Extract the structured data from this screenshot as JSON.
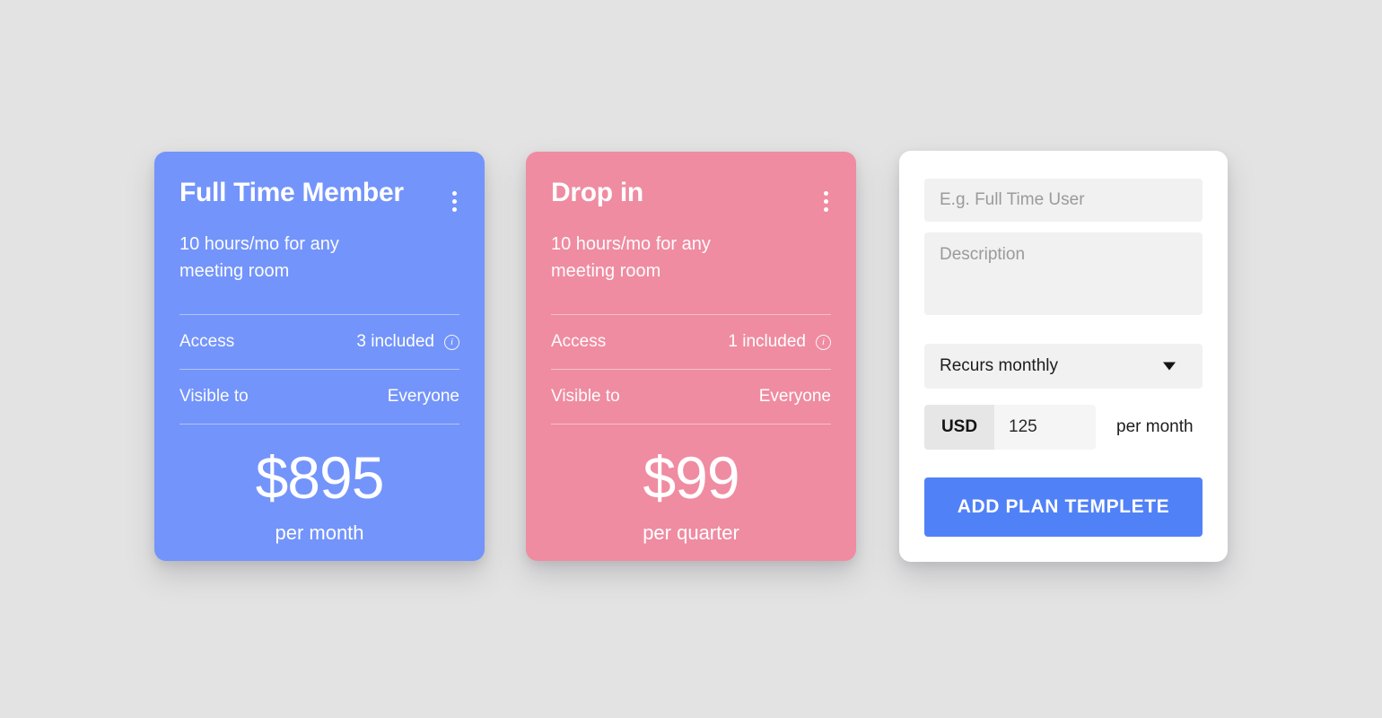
{
  "theme": {
    "background": "#e3e3e3",
    "plan_blue": "#7394fa",
    "plan_pink": "#ef8ca1",
    "accent_button": "#5181f7",
    "field_background": "#f1f1f1",
    "currency_chip_background": "#e6e6e6"
  },
  "plans": [
    {
      "title": "Full Time Member",
      "subtitle": "10 hours/mo for any meeting room",
      "menu_icon": "kebab-menu-icon",
      "rows": [
        {
          "label": "Access",
          "value": "3 included",
          "info_icon": "info-icon"
        },
        {
          "label": "Visible to",
          "value": "Everyone"
        }
      ],
      "price": "$895",
      "period": "per month"
    },
    {
      "title": "Drop in",
      "subtitle": "10 hours/mo for any meeting room",
      "menu_icon": "kebab-menu-icon",
      "rows": [
        {
          "label": "Access",
          "value": "1 included",
          "info_icon": "info-icon"
        },
        {
          "label": "Visible to",
          "value": "Everyone"
        }
      ],
      "price": "$99",
      "period": "per quarter"
    }
  ],
  "form": {
    "name_placeholder": "E.g. Full Time User",
    "name_value": "",
    "description_placeholder": "Description",
    "description_value": "",
    "recurrence_selected": "Recurs monthly",
    "recurrence_caret_icon": "chevron-down-icon",
    "currency": "USD",
    "amount_value": "125",
    "amount_placeholder": "",
    "period_label": "per month",
    "submit_label": "ADD PLAN TEMPLETE"
  }
}
